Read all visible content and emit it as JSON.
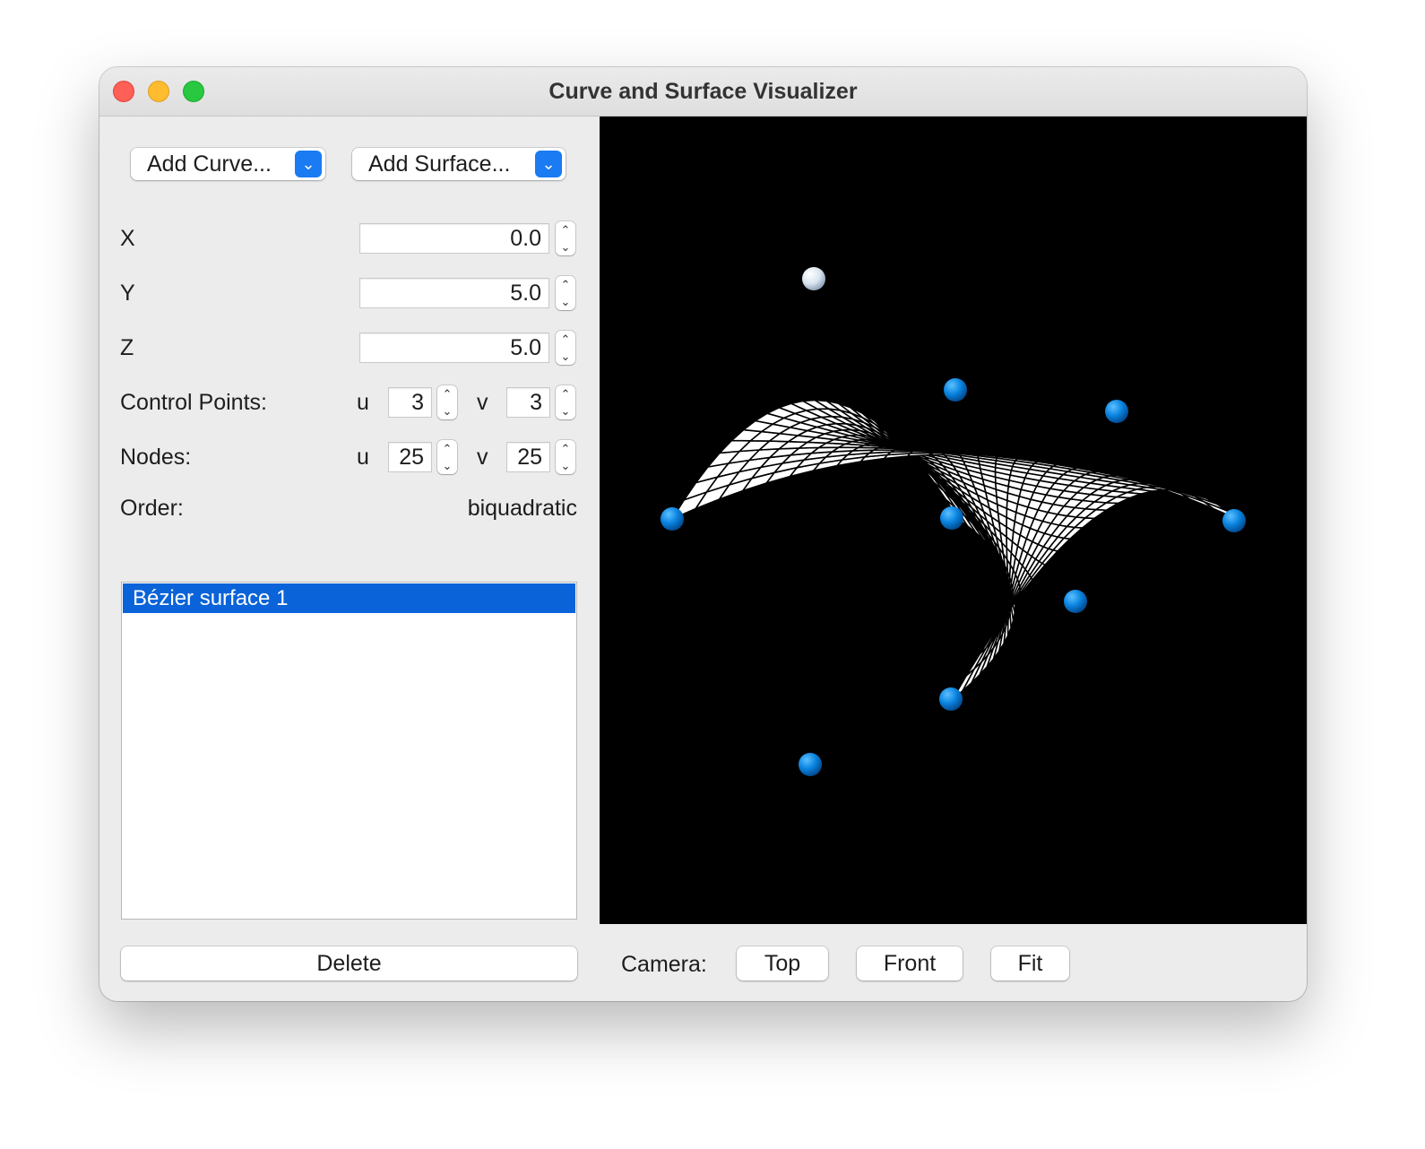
{
  "window": {
    "title": "Curve and Surface Visualizer"
  },
  "toolbar": {
    "add_curve": "Add Curve...",
    "add_surface": "Add Surface..."
  },
  "position": {
    "x_label": "X",
    "x_value": "0.0",
    "y_label": "Y",
    "y_value": "5.0",
    "z_label": "Z",
    "z_value": "5.0"
  },
  "control_points": {
    "label": "Control Points:",
    "u_label": "u",
    "u_value": "3",
    "v_label": "v",
    "v_value": "3"
  },
  "nodes": {
    "label": "Nodes:",
    "u_label": "u",
    "u_value": "25",
    "v_label": "v",
    "v_value": "25"
  },
  "order": {
    "label": "Order:",
    "value": "biquadratic"
  },
  "objects": {
    "items": [
      "Bézier surface 1"
    ],
    "selected": 0
  },
  "delete_label": "Delete",
  "camera": {
    "label": "Camera:",
    "top": "Top",
    "front": "Front",
    "fit": "Fit"
  },
  "colors": {
    "accent": "#0a63d8",
    "control_point": "#0a84e0",
    "control_point_selected": "#d8e4f0",
    "viewport_bg": "#000000",
    "mesh": "#ffffff"
  },
  "icons": {
    "window_close": "close-icon",
    "window_minimize": "minimize-icon",
    "window_zoom": "zoom-icon",
    "combo_arrow": "chevron-down-icon",
    "stepper": "stepper-arrows-icon"
  }
}
